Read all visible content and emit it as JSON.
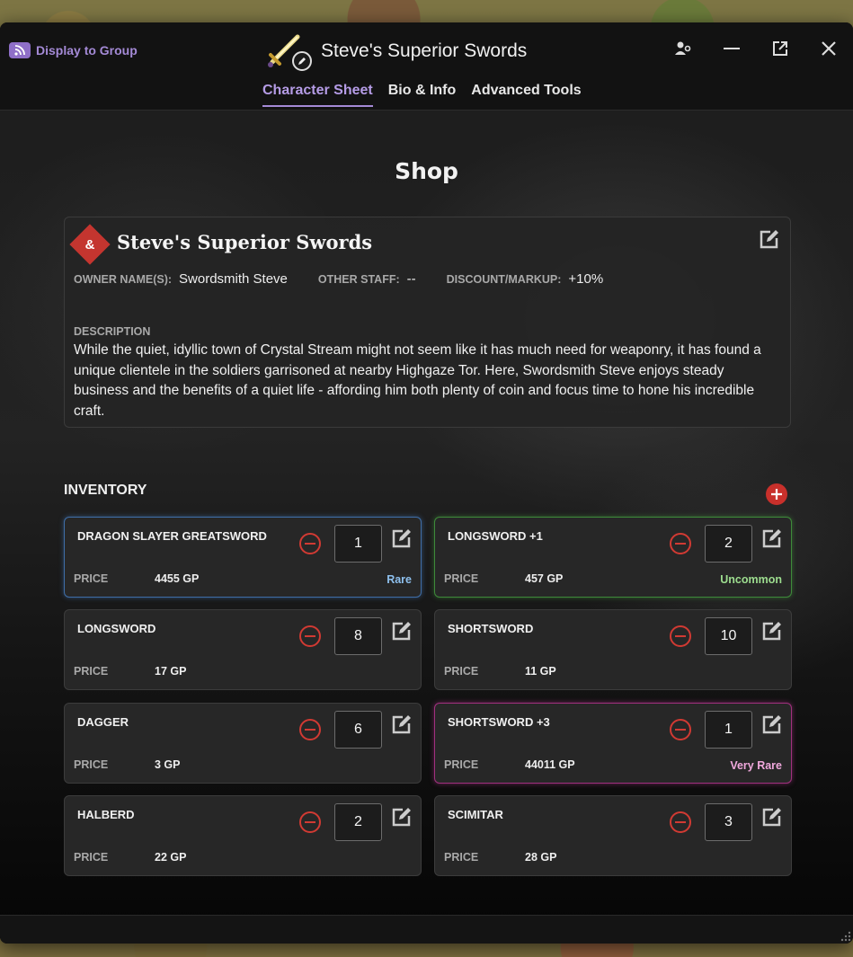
{
  "header": {
    "display_to_group": "Display to Group",
    "title": "Steve's Superior Swords",
    "tabs": [
      {
        "label": "Character Sheet",
        "active": true
      },
      {
        "label": "Bio & Info",
        "active": false
      },
      {
        "label": "Advanced Tools",
        "active": false
      }
    ],
    "icons": [
      "rss-icon",
      "user-settings-icon",
      "minimize-icon",
      "pop-out-icon",
      "close-icon"
    ]
  },
  "shop": {
    "heading": "Shop",
    "logo_glyph": "&",
    "name": "Steve's Superior Swords",
    "owner_label": "OWNER NAME(S):",
    "owner_value": "Swordsmith Steve",
    "staff_label": "OTHER STAFF:",
    "staff_value": "--",
    "discount_label": "DISCOUNT/MARKUP:",
    "discount_value": "+10%",
    "description_label": "DESCRIPTION",
    "description": "While the quiet, idyllic town of Crystal Stream might not seem like it has much need for weaponry, it has found a unique clientele in the soldiers garrisoned at nearby Highgaze Tor. Here, Swordsmith Steve enjoys steady business and the benefits of a quiet life - affording him both plenty of coin and focus time to hone his incredible craft."
  },
  "inventory": {
    "title": "INVENTORY",
    "price_label": "PRICE",
    "items": [
      {
        "name": "DRAGON SLAYER GREATSWORD",
        "qty": "1",
        "price": "4455 GP",
        "rarity": "Rare"
      },
      {
        "name": "LONGSWORD +1",
        "qty": "2",
        "price": "457 GP",
        "rarity": "Uncommon"
      },
      {
        "name": "LONGSWORD",
        "qty": "8",
        "price": "17 GP",
        "rarity": ""
      },
      {
        "name": "SHORTSWORD",
        "qty": "10",
        "price": "11 GP",
        "rarity": ""
      },
      {
        "name": "DAGGER",
        "qty": "6",
        "price": "3 GP",
        "rarity": ""
      },
      {
        "name": "SHORTSWORD +3",
        "qty": "1",
        "price": "44011 GP",
        "rarity": "Very Rare"
      },
      {
        "name": "HALBERD",
        "qty": "2",
        "price": "22 GP",
        "rarity": ""
      },
      {
        "name": "SCIMITAR",
        "qty": "3",
        "price": "28 GP",
        "rarity": ""
      }
    ]
  },
  "colors": {
    "accent": "#a48ad6",
    "danger": "#d13a33",
    "rare": "#3f6ea8",
    "uncommon": "#3e8a3a",
    "very_rare": "#a1307f"
  }
}
